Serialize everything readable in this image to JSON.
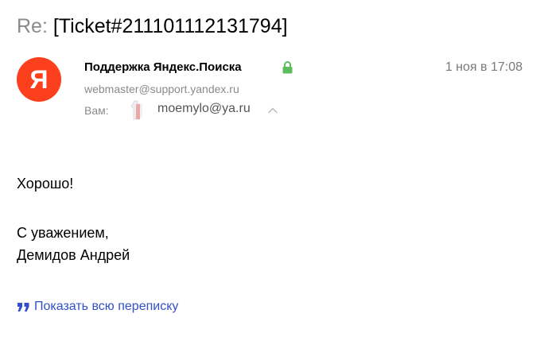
{
  "message": {
    "subject_prefix": "Re:",
    "subject": "[Ticket#211101112131794]",
    "sender": {
      "avatar_letter": "Я",
      "name": "Поддержка Яндекс.Поиска",
      "email": "webmaster@support.yandex.ru",
      "verified_icon": "lock-icon"
    },
    "date": "1 ноя в 17:08",
    "recipients": {
      "label": "Вам:",
      "email": "moemylo@ya.ru"
    },
    "body_lines": [
      "Хорошо!",
      "С уважением,",
      "Демидов Андрей"
    ],
    "show_thread_label": "Показать всю переписку"
  },
  "colors": {
    "avatar_bg": "#fc3f1d",
    "lock": "#5cbc5c",
    "link": "#3250c8",
    "muted": "#8a8a8a"
  }
}
